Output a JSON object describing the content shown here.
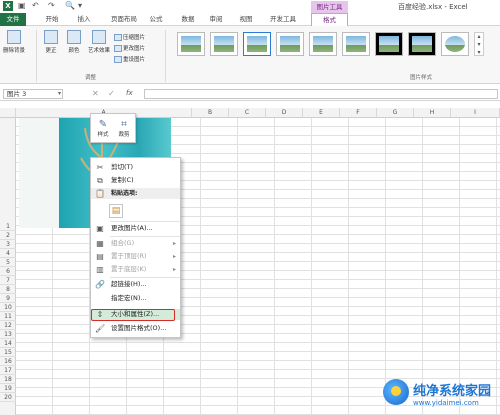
{
  "titlebar": {
    "app_icon": "X",
    "title": "百度经验.xlsx - Excel",
    "context_group": "图片工具"
  },
  "tabs": [
    "文件",
    "开始",
    "插入",
    "页面布局",
    "公式",
    "数据",
    "审阅",
    "视图",
    "开发工具",
    "格式"
  ],
  "ribbon": {
    "remove_bg": "删除背景",
    "corrections": "更正",
    "color": "颜色",
    "artistic": "艺术效果",
    "compress": "压缩图片",
    "change_pic": "更改图片",
    "reset_pic": "重设图片",
    "group_adjust": "调整",
    "group_styles": "图片样式"
  },
  "formula_bar": {
    "name_box": "图片 3",
    "fx": "fx"
  },
  "columns": [
    "A",
    "B",
    "C",
    "D",
    "E",
    "F",
    "G",
    "H",
    "I"
  ],
  "rows": [
    "1",
    "2",
    "3",
    "4",
    "5",
    "6",
    "7",
    "8",
    "9",
    "10",
    "11",
    "12",
    "13",
    "14",
    "15",
    "16",
    "17",
    "18",
    "19",
    "20"
  ],
  "mini_toolbar": {
    "style": "样式",
    "crop": "裁剪"
  },
  "context_menu": {
    "cut": "剪切(T)",
    "copy": "复制(C)",
    "paste_options": "粘贴选项:",
    "change_picture": "更改图片(A)...",
    "group": "组合(G)",
    "bring_front": "置于顶层(R)",
    "send_back": "置于底层(K)",
    "hyperlink": "超链接(H)...",
    "assign_macro": "指定宏(N)...",
    "size_props": "大小和属性(Z)...",
    "format_picture": "设置图片格式(O)..."
  },
  "watermark": {
    "brand": "纯净系统家园",
    "url": "www.yidaimei.com"
  },
  "colors": {
    "excel_green": "#217346",
    "context_purple": "#7a2a86",
    "highlight": "#d5ebd9",
    "red_box": "#d42a2a"
  }
}
